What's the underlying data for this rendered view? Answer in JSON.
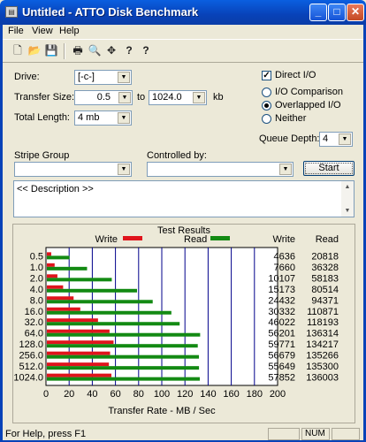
{
  "window": {
    "title": "Untitled - ATTO Disk Benchmark",
    "app_icon": "disk-app-icon",
    "buttons": {
      "minimize": "_",
      "maximize": "□",
      "close": "✕"
    }
  },
  "menu": [
    "File",
    "View",
    "Help"
  ],
  "toolbar": {
    "icons": [
      "new-document-icon",
      "open-folder-icon",
      "save-icon",
      "print-icon",
      "print-preview-icon",
      "move-icon",
      "help-icon",
      "context-help-icon"
    ],
    "glyphs": [
      "🗋",
      "📂",
      "💾",
      "🖶",
      "🔍",
      "✥",
      "?",
      "?"
    ]
  },
  "form": {
    "drive_label": "Drive:",
    "drive_value": "[-c-]",
    "transfer_size_label": "Transfer Size:",
    "transfer_from": "0.5",
    "to_label": "to",
    "transfer_to": "1024.0",
    "kb_label": "kb",
    "total_length_label": "Total Length:",
    "total_length_value": "4 mb",
    "direct_io_label": "Direct I/O",
    "direct_io_checked": true,
    "io_comparison_label": "I/O Comparison",
    "overlapped_io_label": "Overlapped I/O",
    "neither_label": "Neither",
    "selected_io": "Overlapped I/O",
    "queue_depth_label": "Queue Depth:",
    "queue_depth_value": "4",
    "stripe_group_label": "Stripe Group",
    "stripe_group_value": "",
    "controlled_by_label": "Controlled by:",
    "controlled_by_value": "",
    "start_label": "Start",
    "description": "<< Description >>"
  },
  "colors": {
    "write": "#e0141c",
    "read": "#138a13",
    "grid": "#00008b",
    "plot_bg": "#ffffff"
  },
  "status": {
    "text": "For Help, press F1",
    "num": "NUM"
  },
  "chart_data": {
    "type": "bar",
    "title": "Test Results",
    "xlabel": "Transfer Rate - MB / Sec",
    "xlim": [
      0,
      200
    ],
    "xticks": [
      0,
      20,
      40,
      60,
      80,
      100,
      120,
      140,
      160,
      180,
      200
    ],
    "legend": [
      "Write",
      "Read"
    ],
    "column_headers": [
      "Write",
      "Read"
    ],
    "categories": [
      "0.5",
      "1.0",
      "2.0",
      "4.0",
      "8.0",
      "16.0",
      "32.0",
      "64.0",
      "128.0",
      "256.0",
      "512.0",
      "1024.0"
    ],
    "series": [
      {
        "name": "Write",
        "values": [
          4636,
          7660,
          10107,
          15173,
          24432,
          30332,
          46022,
          56201,
          59771,
          56679,
          55649,
          57852
        ]
      },
      {
        "name": "Read",
        "values": [
          20818,
          36328,
          58183,
          80514,
          94371,
          110871,
          118193,
          136314,
          134217,
          135266,
          135300,
          136003
        ]
      }
    ]
  }
}
